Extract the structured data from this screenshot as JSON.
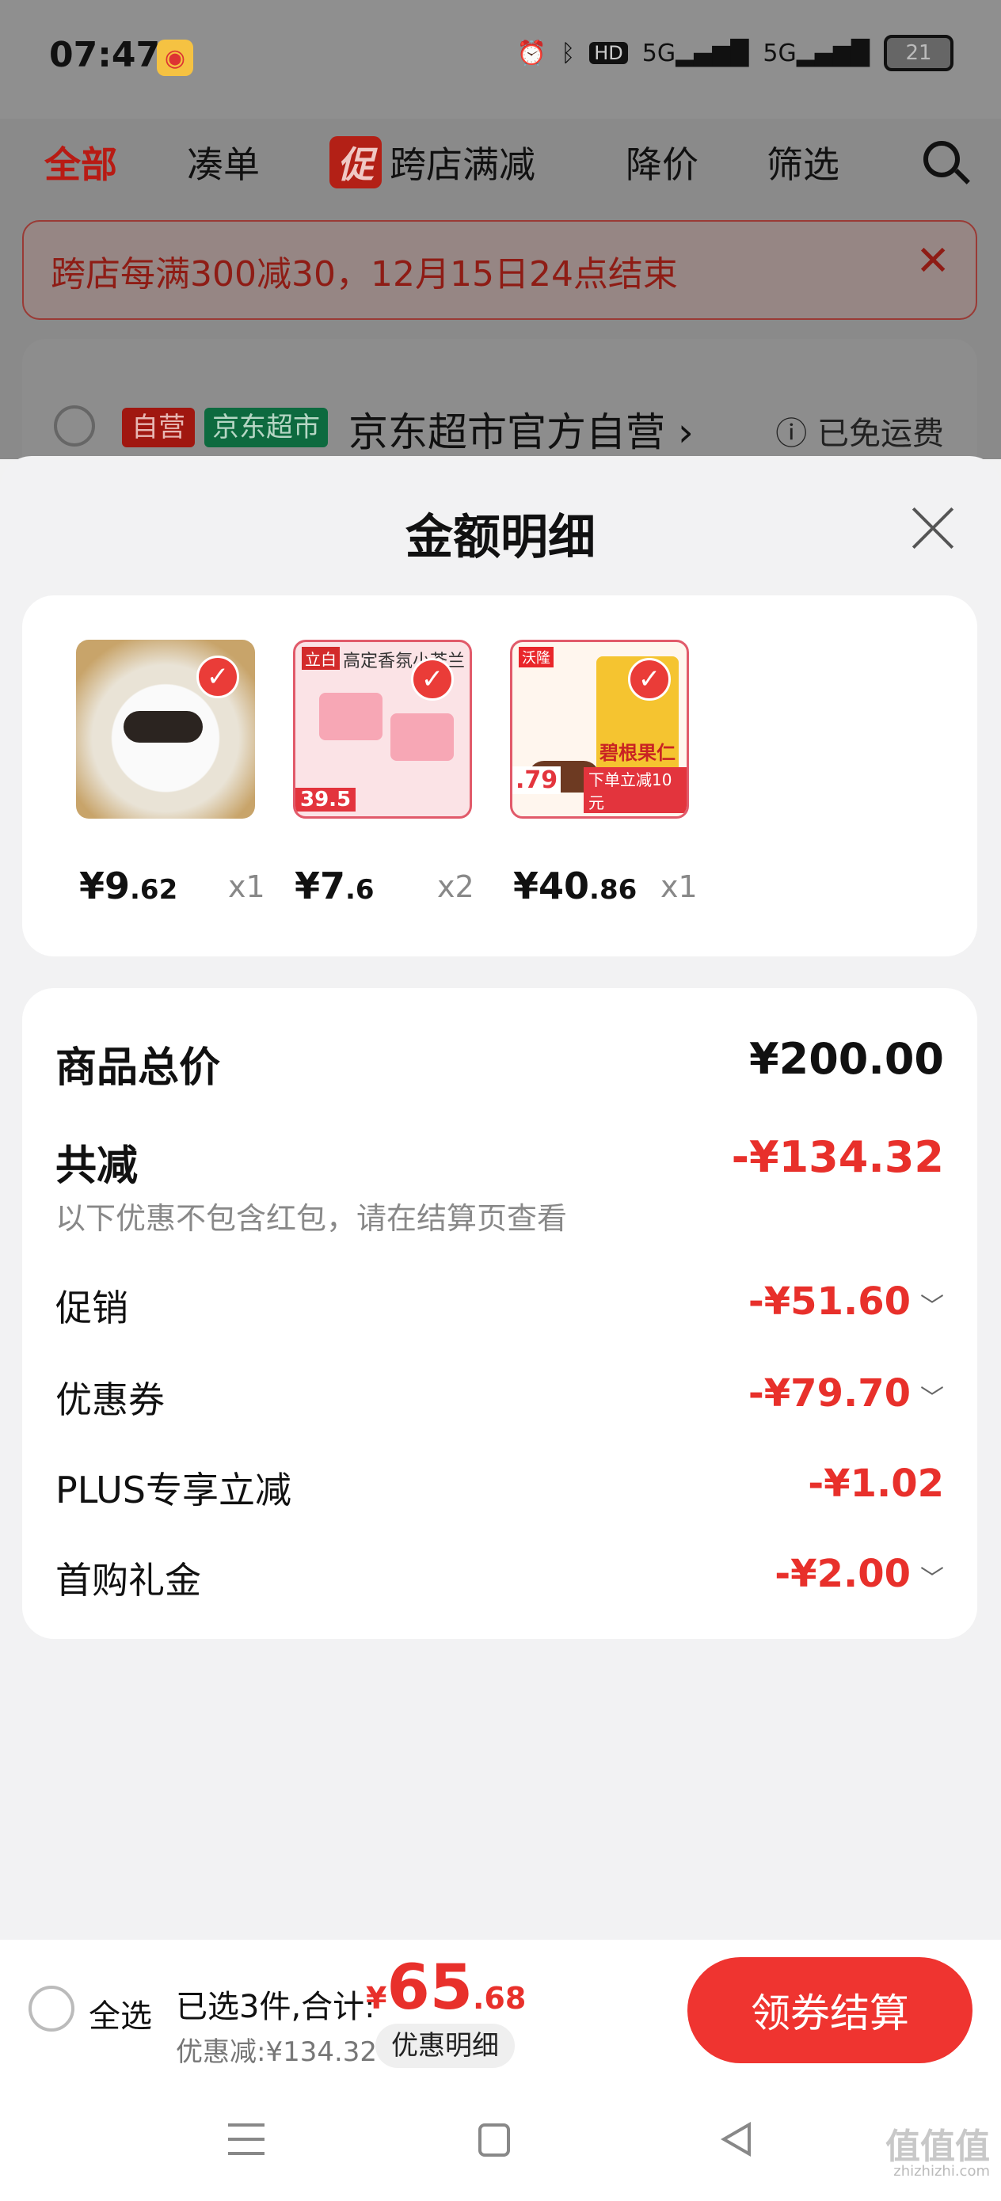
{
  "status_bar": {
    "time": "07:47",
    "icons": [
      "alarm-icon",
      "bluetooth-icon",
      "hd-icon",
      "5g-signal-icon",
      "5g-signal-icon"
    ],
    "battery": "21"
  },
  "tabs": [
    {
      "label": "全部",
      "active": true
    },
    {
      "label": "凑单"
    },
    {
      "label": "跨店满减",
      "badge": "促"
    },
    {
      "label": "降价"
    },
    {
      "label": "筛选"
    }
  ],
  "banner": {
    "text": "跨店每满300减30，12月15日24点结束"
  },
  "store": {
    "tag_self": "自营",
    "tag_jd": "京东超市",
    "name": "京东超市官方自营",
    "shipping": "已免运费"
  },
  "sheet": {
    "title": "金额明细",
    "products": [
      {
        "price_int": "¥9",
        "price_dec": ".62",
        "qty": "x1"
      },
      {
        "price_int": "¥7",
        "price_dec": ".6",
        "qty": "x2",
        "img_brand": "立白",
        "img_text": "高定香氛小苍兰",
        "img_price": "39.5"
      },
      {
        "price_int": "¥40",
        "price_dec": ".86",
        "qty": "x1",
        "img_brand": "沃隆",
        "img_text": "碧根果仁",
        "img_price": ".79",
        "img_promo": "下单立减10元"
      }
    ],
    "summary": {
      "total_label": "商品总价",
      "total_value": "¥200.00",
      "reduce_label": "共减",
      "reduce_value": "-¥134.32",
      "note": "以下优惠不包含红包，请在结算页查看",
      "items": [
        {
          "label": "促销",
          "value": "-¥51.60",
          "expandable": true
        },
        {
          "label": "优惠券",
          "value": "-¥79.70",
          "expandable": true
        },
        {
          "label": "PLUS专享立减",
          "value": "-¥1.02",
          "expandable": false
        },
        {
          "label": "首购礼金",
          "value": "-¥2.00",
          "expandable": true
        }
      ]
    }
  },
  "bottom": {
    "select_all": "全选",
    "selected_text": "已选3件,合计:",
    "total_currency": "¥",
    "total_int": "65",
    "total_dec": ".68",
    "discount_text": "优惠减:¥134.32",
    "detail_button": "优惠明细",
    "checkout_button": "领券结算"
  },
  "watermark": {
    "text": "值值值",
    "url": "zhizhizhi.com"
  },
  "colors": {
    "accent": "#e8302b",
    "checkout": "#ef3430",
    "jd_green": "#0d6a3f"
  }
}
